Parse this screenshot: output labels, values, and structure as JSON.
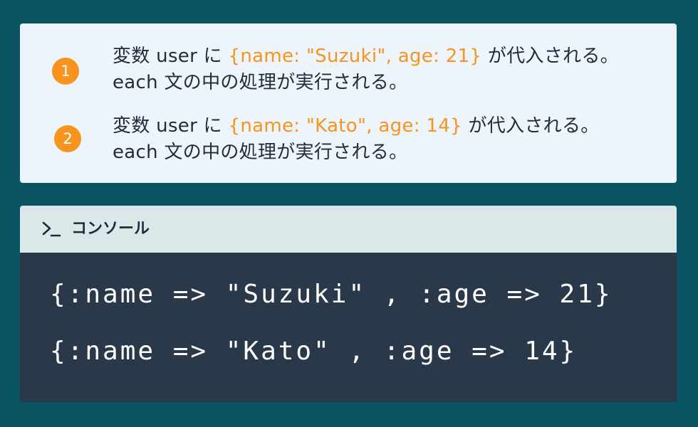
{
  "steps": [
    {
      "number": "1",
      "line1_prefix": "変数 user に ",
      "line1_code": "{name: \"Suzuki\", age: 21}",
      "line1_suffix": " が代入される。",
      "line2": "each 文の中の処理が実行される。"
    },
    {
      "number": "2",
      "line1_prefix": "変数 user に ",
      "line1_code": "{name: \"Kato\", age: 14}",
      "line1_suffix": " が代入される。",
      "line2": "each 文の中の処理が実行される。"
    }
  ],
  "console": {
    "icon": "terminal-prompt-icon",
    "title": "コンソール",
    "output": [
      "{:name => \"Suzuki\" , :age => 21}",
      "{:name => \"Kato\" , :age => 14}"
    ]
  },
  "colors": {
    "background": "#0b5463",
    "accent": "#f7941d",
    "console_header": "#dbe7e8",
    "console_body": "#29394a"
  }
}
